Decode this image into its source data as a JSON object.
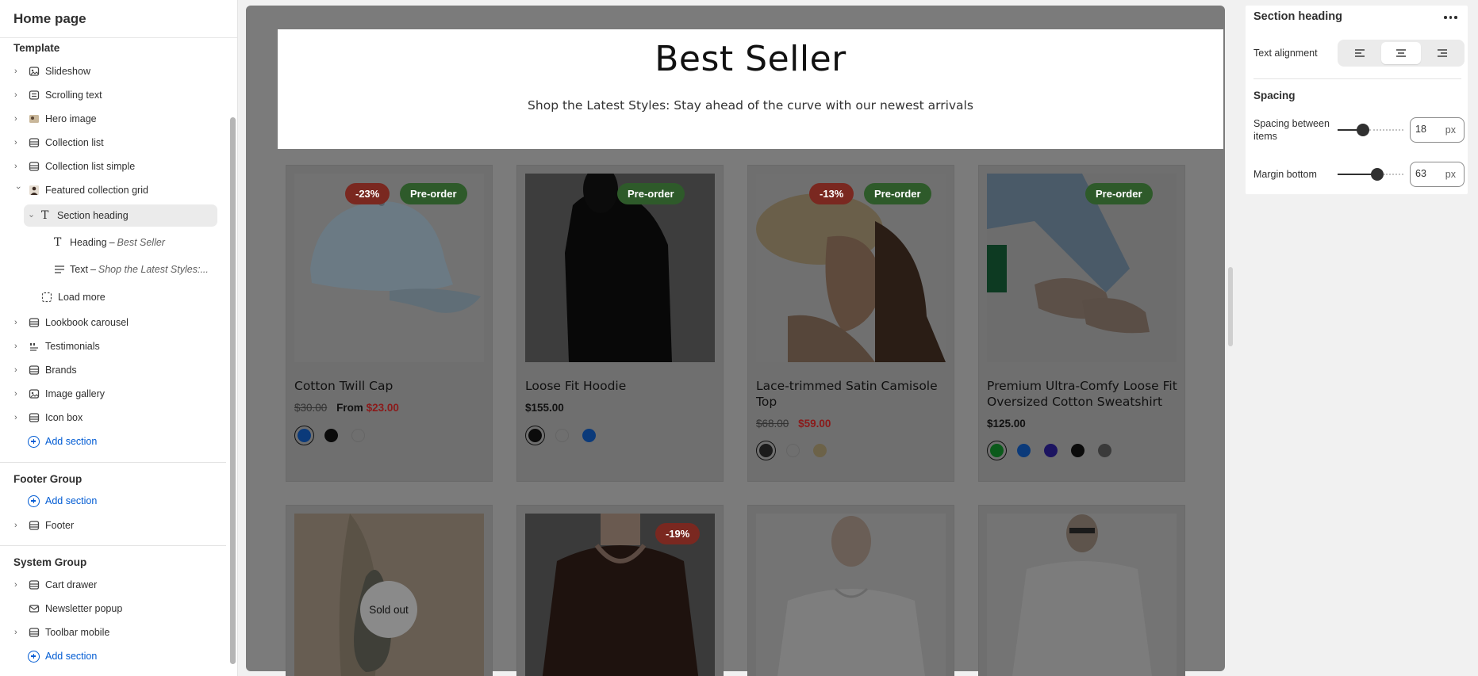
{
  "sidebar": {
    "title": "Home page",
    "template_group": {
      "title": "Template",
      "items": [
        {
          "label": "Slideshow",
          "icon": "slideshow-icon"
        },
        {
          "label": "Scrolling text",
          "icon": "scrolling-text-icon"
        },
        {
          "label": "Hero image",
          "icon": "hero-image-icon"
        },
        {
          "label": "Collection list",
          "icon": "section-icon"
        },
        {
          "label": "Collection list simple",
          "icon": "section-icon"
        },
        {
          "label": "Featured collection grid",
          "icon": "featured-collection-icon",
          "expanded": true
        }
      ],
      "featured_children": {
        "section_heading": "Section heading",
        "heading_label": "Heading",
        "heading_value": "Best Seller",
        "text_label": "Text",
        "text_value": "Shop the Latest Styles:...",
        "load_more": "Load more"
      },
      "items_after": [
        {
          "label": "Lookbook carousel",
          "icon": "section-icon"
        },
        {
          "label": "Testimonials",
          "icon": "testimonials-icon"
        },
        {
          "label": "Brands",
          "icon": "section-icon"
        },
        {
          "label": "Image gallery",
          "icon": "image-gallery-icon"
        },
        {
          "label": "Icon box",
          "icon": "section-icon"
        }
      ],
      "add_section": "Add section"
    },
    "footer_group": {
      "title": "Footer Group",
      "add_section": "Add section",
      "items": [
        {
          "label": "Footer",
          "icon": "section-icon"
        }
      ]
    },
    "system_group": {
      "title": "System Group",
      "items": [
        {
          "label": "Cart drawer",
          "icon": "section-icon"
        },
        {
          "label": "Newsletter popup",
          "icon": "email-icon"
        },
        {
          "label": "Toolbar mobile",
          "icon": "section-icon"
        }
      ],
      "add_section": "Add section"
    }
  },
  "preview": {
    "heading": "Best Seller",
    "subheading": "Shop the Latest Styles: Stay ahead of the curve with our newest arrivals",
    "products": [
      {
        "name": "Cotton Twill Cap",
        "price_old": "$30.00",
        "price_prefix": "From",
        "price_new": "$23.00",
        "badges": [
          {
            "text": "-23%",
            "type": "sale"
          },
          {
            "text": "Pre-order",
            "type": "pre"
          }
        ],
        "swatches": [
          "#0b3a7a",
          "#0b0b0b",
          "#6f6f6f"
        ]
      },
      {
        "name": "Loose Fit Hoodie",
        "price": "$155.00",
        "badges": [
          {
            "text": "Pre-order",
            "type": "pre"
          }
        ],
        "swatches": [
          "#0b0b0b",
          "#6f6f6f",
          "#0b3a7a"
        ]
      },
      {
        "name": "Lace-trimmed Satin Camisole Top",
        "price_old": "$68.00",
        "price_new": "$59.00",
        "badges": [
          {
            "text": "-13%",
            "type": "sale"
          },
          {
            "text": "Pre-order",
            "type": "pre"
          }
        ],
        "swatches": [
          "#1b1b1b",
          "#6f6f6f",
          "#6c6248"
        ]
      },
      {
        "name": "Premium Ultra-Comfy Loose Fit Oversized Cotton Sweatshirt fo...",
        "price": "$125.00",
        "badges": [
          {
            "text": "Pre-order",
            "type": "pre"
          }
        ],
        "swatches": [
          "#0b5a1b",
          "#0b3a7a",
          "#1c1460",
          "#0b0b0b",
          "#3a3a3a"
        ]
      }
    ],
    "row2": [
      {
        "badge": "",
        "sold_out": "Sold out"
      },
      {
        "badge": "-19%"
      },
      {
        "badge": ""
      },
      {
        "badge": ""
      }
    ]
  },
  "settings": {
    "title": "Section heading",
    "text_alignment_label": "Text alignment",
    "alignment_selected": "center",
    "spacing_title": "Spacing",
    "spacing_between_label": "Spacing between items",
    "spacing_between_value": "18",
    "spacing_between_fraction": 0.36,
    "margin_bottom_label": "Margin bottom",
    "margin_bottom_value": "63",
    "margin_bottom_fraction": 0.63,
    "unit": "px"
  },
  "colors": {
    "accent_blue": "#005bd3",
    "badge_sale": "#c2362b",
    "badge_pre": "#3e8a37",
    "price_sale": "#c0262b"
  }
}
